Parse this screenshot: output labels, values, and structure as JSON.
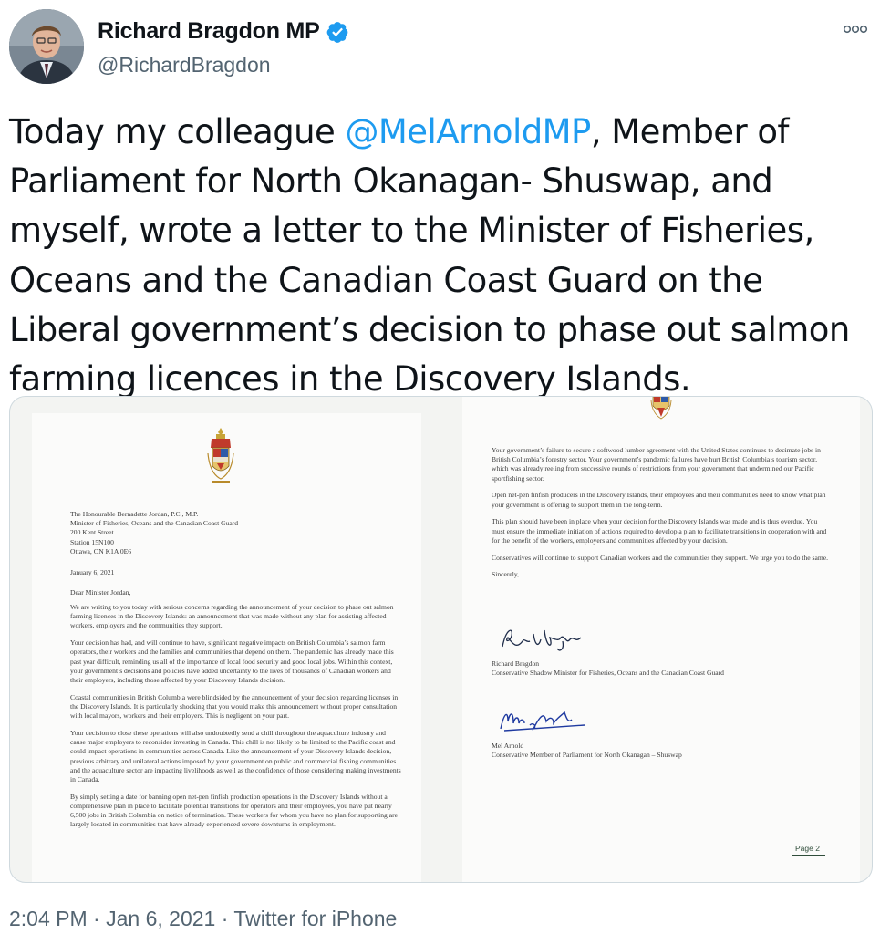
{
  "tweet": {
    "display_name": "Richard Bragdon MP",
    "handle": "@RichardBragdon",
    "verified": true,
    "text_before": "Today my colleague ",
    "mention": "@MelArnoldMP",
    "text_after": ", Member of Parliament for North Okanagan- Shuswap, and myself, wrote a letter to the Minister of Fisheries, Oceans and the Canadian Coast Guard on the Liberal government’s decision to phase out salmon farming licences in the Discovery Islands.",
    "timestamp": "2:04 PM",
    "date": "Jan 6, 2021",
    "source": "Twitter for iPhone",
    "separator": " · ",
    "mention_color": "#1d9bf0",
    "verified_color": "#1d9bf0",
    "more_icon": "more-options-icon"
  },
  "letter": {
    "page1": {
      "address": "The Honourable Bernadette Jordan, P.C., M.P.\nMinister of Fisheries, Oceans and the Canadian Coast Guard\n200 Kent Street\nStation 15N100\nOttawa, ON K1A 0E6",
      "date": "January 6, 2021",
      "salutation": "Dear Minister Jordan,",
      "paragraphs": [
        "We are writing to you today with serious concerns regarding the announcement of your decision to phase out salmon farming licences in the Discovery Islands: an announcement that was made without any plan for assisting affected workers, employers and the communities they support.",
        "Your decision has had, and will continue to have, significant negative impacts on British Columbia’s salmon farm operators, their workers and the families and communities that depend on them. The pandemic has already made this past year difficult, reminding us all of the importance of local food security and good local jobs. Within this context, your government’s decisions and policies have added uncertainty to the lives of thousands of Canadian workers and their employers, including those affected by your Discovery Islands decision.",
        "Coastal communities in British Columbia were blindsided by the announcement of your decision regarding licenses in the Discovery Islands. It is particularly shocking that you would make this announcement without proper consultation with local mayors, workers and their employers. This is negligent on your part.",
        "Your decision to close these operations will also undoubtedly send a chill throughout the aquaculture industry and cause major employers to reconsider investing in Canada. This chill is not likely to be limited to the Pacific coast and could impact operations in communities across Canada. Like the announcement of your Discovery Islands decision, previous arbitrary and unilateral actions imposed by your government on public and commercial fishing communities and the aquaculture sector are impacting livelihoods as well as the confidence of those considering making investments in Canada.",
        "By simply setting a date for banning open net-pen finfish production operations in the Discovery Islands without a comprehensive plan in place to facilitate potential transitions for operators and their employees, you have put nearly 6,500 jobs in British Columbia on notice of termination. These workers for whom you have no plan for supporting are largely located in communities that have already experienced severe downturns in employment."
      ]
    },
    "page2": {
      "paragraphs": [
        "Your government’s failure to secure a softwood lumber agreement with the United States continues to decimate jobs in British Columbia’s forestry sector. Your government’s pandemic failures have hurt British Columbia’s tourism sector, which was already reeling from successive rounds of restrictions from your government that undermined our Pacific sportfishing sector.",
        "Open net-pen finfish producers in the Discovery Islands, their employees and their communities need to know what plan your government is offering to support them in the long-term.",
        "This plan should have been in place when your decision for the Discovery Islands was made and is thus overdue. You must ensure the immediate initiation of actions required to develop a plan to facilitate transitions in cooperation with and for the benefit of the workers, employers and communities affected by your decision.",
        "Conservatives will continue to support Canadian workers and the communities they support. We urge you to do the same.",
        "Sincerely,"
      ],
      "signatory1_signature": "Richard Bragdon",
      "signatory1_name": "Richard Bragdon",
      "signatory1_title": "Conservative Shadow Minister for Fisheries, Oceans and the Canadian Coast Guard",
      "signatory2_signature": "Mel Arnold",
      "signatory2_name": "Mel Arnold",
      "signatory2_title": "Conservative Member of Parliament for North Okanagan – Shuswap",
      "page_label": "Page 2"
    }
  }
}
